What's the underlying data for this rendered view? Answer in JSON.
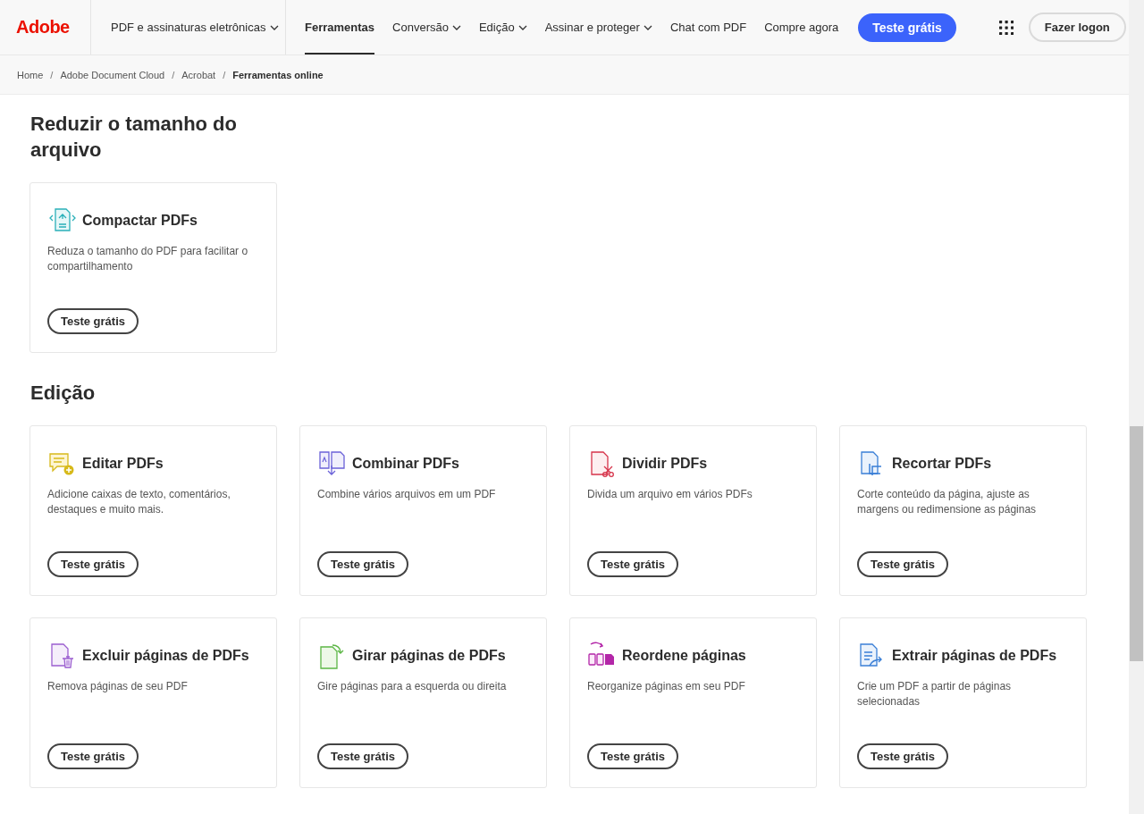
{
  "header": {
    "logo": "Adobe",
    "product_menu": {
      "label": "PDF e assinaturas eletrônicas",
      "has_caret": true
    },
    "nav": [
      {
        "label": "Ferramentas",
        "selected": true,
        "has_caret": false
      },
      {
        "label": "Conversão",
        "selected": false,
        "has_caret": true
      },
      {
        "label": "Edição",
        "selected": false,
        "has_caret": true
      },
      {
        "label": "Assinar e proteger",
        "selected": false,
        "has_caret": true
      },
      {
        "label": "Chat com PDF",
        "selected": false,
        "has_caret": false
      },
      {
        "label": "Compre agora",
        "selected": false,
        "has_caret": false
      }
    ],
    "cta_button": "Teste grátis",
    "sign_in_button": "Fazer logon"
  },
  "breadcrumb": [
    {
      "label": "Home",
      "current": false
    },
    {
      "label": "Adobe Document Cloud",
      "current": false
    },
    {
      "label": "Acrobat",
      "current": false
    },
    {
      "label": "Ferramentas online",
      "current": true
    }
  ],
  "breadcrumb_separator": "/",
  "sections": [
    {
      "title": "Reduzir o tamanho do arquivo",
      "tools": [
        {
          "kind": "compress",
          "title": "Compactar PDFs",
          "description": "Reduza o tamanho do PDF para facilitar o compartilhamento",
          "button": "Teste grátis"
        }
      ]
    },
    {
      "title": "Edição",
      "tools": [
        {
          "kind": "edit",
          "title": "Editar PDFs",
          "description": "Adicione caixas de texto, comentários, destaques e muito mais.",
          "button": "Teste grátis"
        },
        {
          "kind": "combine",
          "title": "Combinar PDFs",
          "description": "Combine vários arquivos em um PDF",
          "button": "Teste grátis"
        },
        {
          "kind": "split",
          "title": "Dividir PDFs",
          "description": "Divida um arquivo em vários PDFs",
          "button": "Teste grátis"
        },
        {
          "kind": "crop",
          "title": "Recortar PDFs",
          "description": "Corte conteúdo da página, ajuste as margens ou redimensione as páginas",
          "button": "Teste grátis"
        },
        {
          "kind": "delete",
          "title": "Excluir páginas de PDFs",
          "description": "Remova páginas de seu PDF",
          "button": "Teste grátis"
        },
        {
          "kind": "rotate",
          "title": "Girar páginas de PDFs",
          "description": "Gire páginas para a esquerda ou direita",
          "button": "Teste grátis"
        },
        {
          "kind": "reorder",
          "title": "Reordene páginas",
          "description": "Reorganize páginas em seu PDF",
          "button": "Teste grátis"
        },
        {
          "kind": "extract",
          "title": "Extrair páginas de PDFs",
          "description": "Crie um PDF a partir de páginas selecionadas",
          "button": "Teste grátis"
        }
      ]
    }
  ]
}
